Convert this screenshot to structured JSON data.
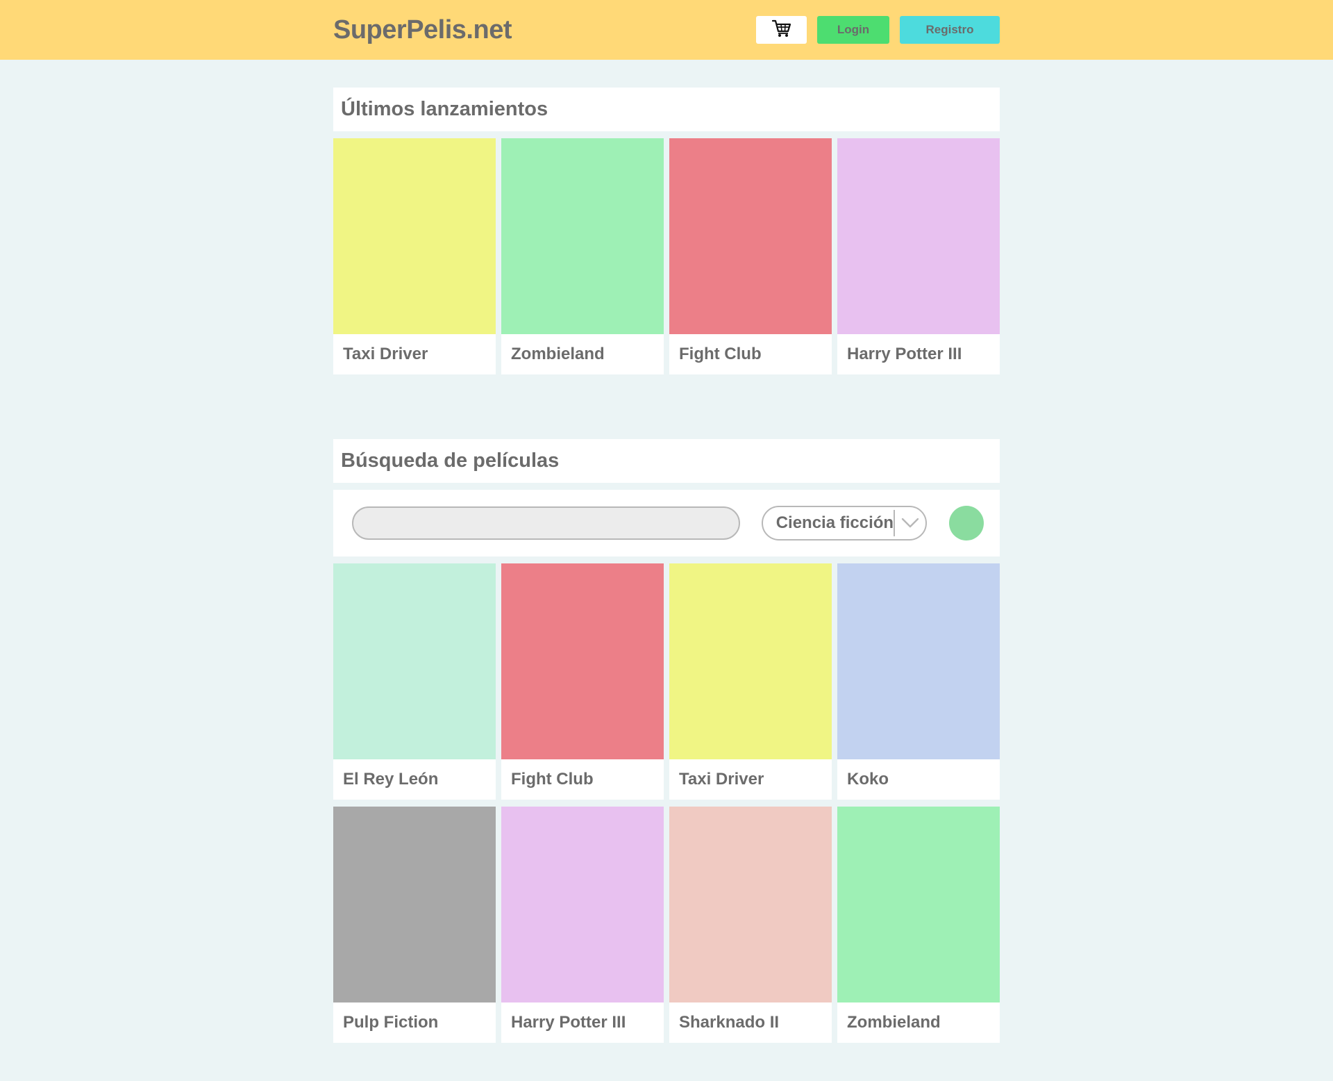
{
  "header": {
    "logo": "SuperPelis.net",
    "cart_icon": "shopping-cart-icon",
    "login_label": "Login",
    "register_label": "Registro",
    "colors": {
      "background": "#ffd977",
      "login": "#4ddd70",
      "register": "#4ddbdd"
    }
  },
  "latest": {
    "title": "Últimos lanzamientos",
    "movies": [
      {
        "title": "Taxi Driver",
        "color": "#f0f584"
      },
      {
        "title": "Zombieland",
        "color": "#9ef0b5"
      },
      {
        "title": "Fight Club",
        "color": "#ec7f88"
      },
      {
        "title": "Harry Potter III",
        "color": "#e8c1f0"
      }
    ]
  },
  "search": {
    "title": "Búsqueda de películas",
    "input_value": "",
    "genre_selected": "Ciencia ficción",
    "genre_icon": "chevron-down-icon",
    "go_color": "#8adc9f",
    "results": [
      {
        "title": "El Rey León",
        "color": "#c2f0dc"
      },
      {
        "title": "Fight Club",
        "color": "#ec7f88"
      },
      {
        "title": "Taxi Driver",
        "color": "#f0f584"
      },
      {
        "title": "Koko",
        "color": "#c2d2f0"
      },
      {
        "title": "Pulp Fiction",
        "color": "#a8a8a8"
      },
      {
        "title": "Harry Potter III",
        "color": "#e8c1f0"
      },
      {
        "title": "Sharknado II",
        "color": "#f0cac2"
      },
      {
        "title": "Zombieland",
        "color": "#9ef0b5"
      }
    ]
  }
}
